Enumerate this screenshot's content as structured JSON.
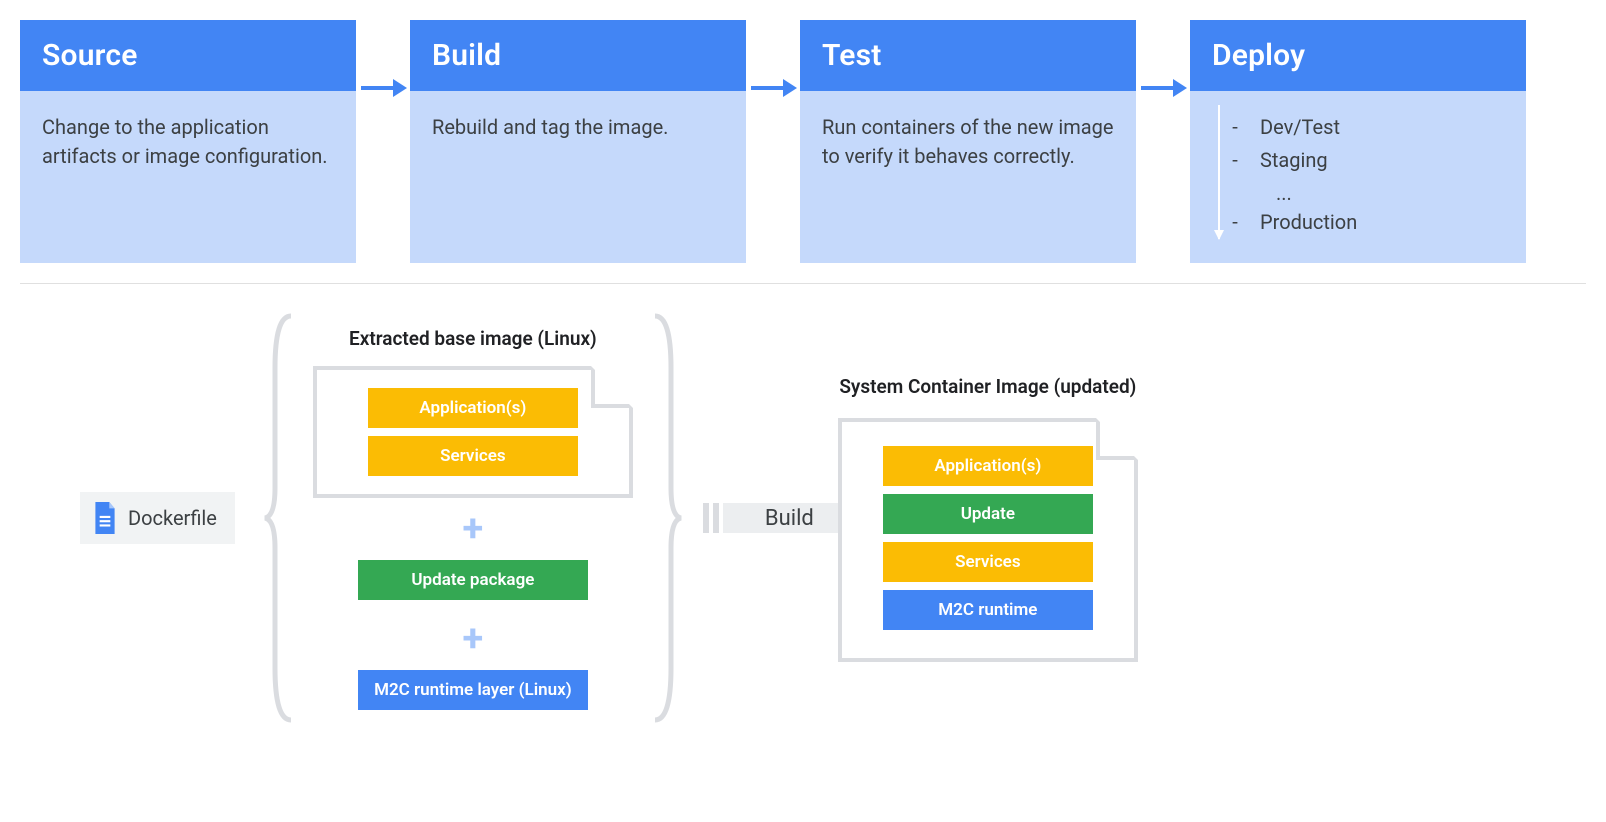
{
  "pipeline": {
    "stages": [
      {
        "title": "Source",
        "body": "Change to the application artifacts or image configuration."
      },
      {
        "title": "Build",
        "body": "Rebuild and tag the image."
      },
      {
        "title": "Test",
        "body": "Run containers of the new image to verify it behaves correctly."
      },
      {
        "title": "Deploy",
        "body": "",
        "items": [
          "Dev/Test",
          "Staging",
          "...",
          "Production"
        ]
      }
    ]
  },
  "bottom": {
    "dockerfile_label": "Dockerfile",
    "extracted_label": "Extracted base image (Linux)",
    "extracted_layers": [
      {
        "text": "Application(s)",
        "color": "yellow"
      },
      {
        "text": "Services",
        "color": "yellow"
      }
    ],
    "update_layer": {
      "text": "Update package",
      "color": "green"
    },
    "runtime_layer": {
      "text": "M2C runtime layer (Linux)",
      "color": "blue"
    },
    "build_label": "Build",
    "result_label": "System Container Image (updated)",
    "result_layers": [
      {
        "text": "Application(s)",
        "color": "yellow"
      },
      {
        "text": "Update",
        "color": "green"
      },
      {
        "text": "Services",
        "color": "yellow"
      },
      {
        "text": "M2C runtime",
        "color": "blue"
      }
    ]
  },
  "colors": {
    "primary_blue": "#4285f4",
    "light_blue": "#c5d9fb",
    "yellow": "#fbbc04",
    "green": "#34a853",
    "gray_border": "#dadce0"
  }
}
